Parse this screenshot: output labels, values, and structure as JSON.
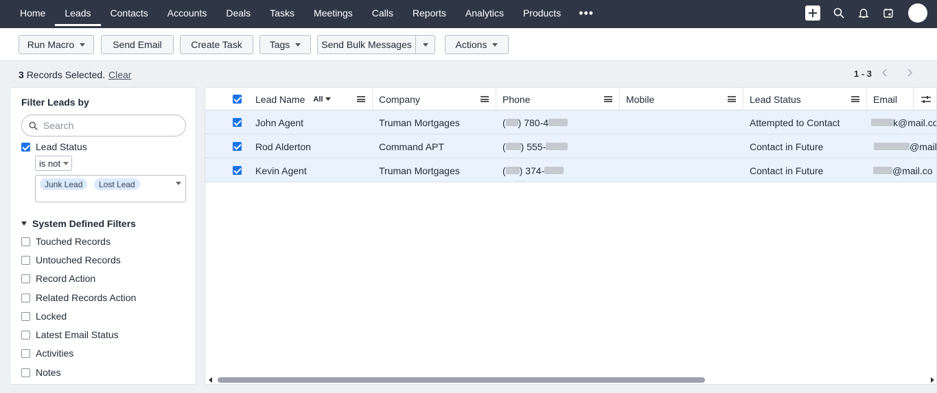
{
  "nav": {
    "items": [
      "Home",
      "Leads",
      "Contacts",
      "Accounts",
      "Deals",
      "Tasks",
      "Meetings",
      "Calls",
      "Reports",
      "Analytics",
      "Products"
    ],
    "active": "Leads",
    "more": "•••"
  },
  "toolbar": {
    "run_macro": "Run Macro",
    "send_email": "Send Email",
    "create_task": "Create Task",
    "tags": "Tags",
    "send_bulk": "Send Bulk Messages",
    "actions": "Actions"
  },
  "selection": {
    "count": "3",
    "text": "Records Selected.",
    "clear": "Clear",
    "pager": "1 - 3"
  },
  "filter": {
    "title": "Filter Leads by",
    "search_placeholder": "Search",
    "lead_status_label": "Lead Status",
    "operator": "is not",
    "chips": [
      "Junk Lead",
      "Lost Lead"
    ],
    "system_defined_title": "System Defined Filters",
    "system_items": [
      "Touched Records",
      "Untouched Records",
      "Record Action",
      "Related Records Action",
      "Locked",
      "Latest Email Status",
      "Activities",
      "Notes"
    ]
  },
  "grid": {
    "columns": [
      "Lead Name",
      "Company",
      "Phone",
      "Mobile",
      "Lead Status",
      "Email"
    ],
    "lead_name_filter": "All",
    "rows": [
      {
        "name": "John Agent",
        "company": "Truman Mortgages",
        "phone_a": "(",
        "phone_b": ") 780-4",
        "mobile": "",
        "status": "Attempted to Contact",
        "email": "k@mail.co"
      },
      {
        "name": "Rod Alderton",
        "company": "Command APT",
        "phone_a": "(",
        "phone_b": ") 555-",
        "mobile": "",
        "status": "Contact in Future",
        "email": "@mail."
      },
      {
        "name": "Kevin Agent",
        "company": "Truman Mortgages",
        "phone_a": "(",
        "phone_b": ") 374-",
        "mobile": "",
        "status": "Contact in Future",
        "email": "@mail.co"
      }
    ]
  },
  "colors": {
    "topbar": "#2f3746",
    "accent": "#1a73e8",
    "row_selected": "#eaf2fd"
  }
}
